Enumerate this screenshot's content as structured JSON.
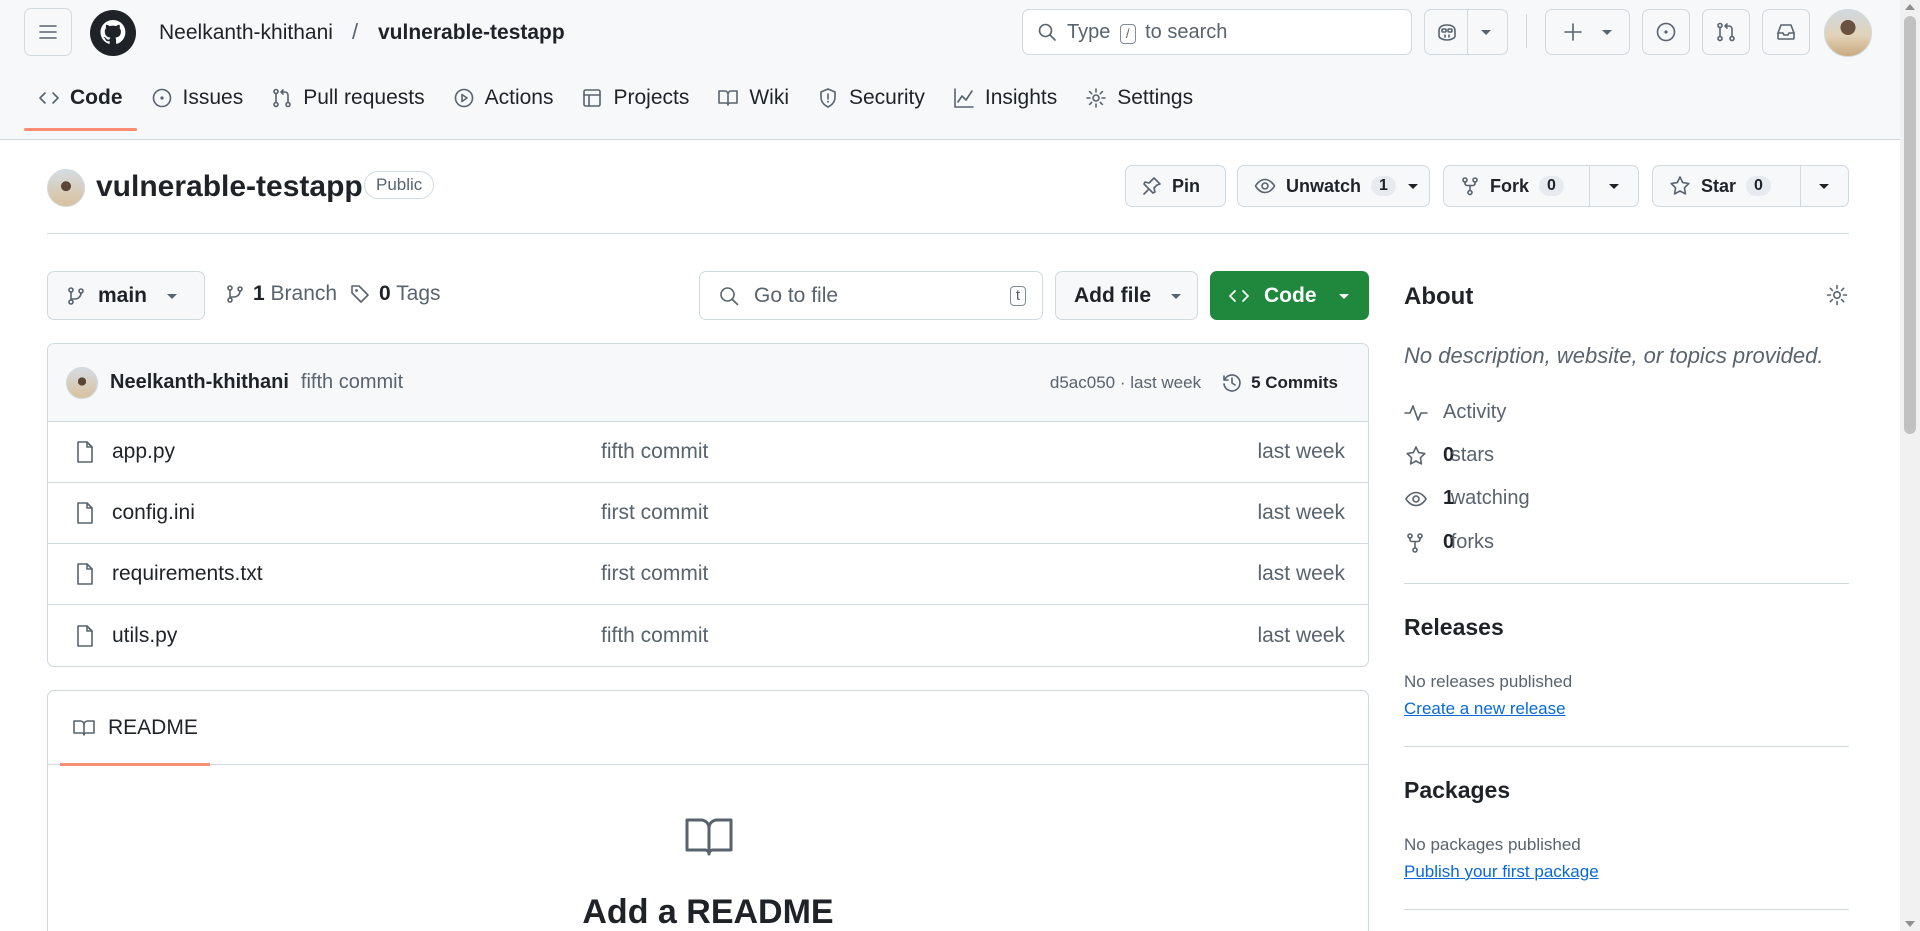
{
  "header": {
    "owner": "Neelkanth-khithani",
    "separator": "/",
    "repo": "vulnerable-testapp",
    "search": {
      "prefix": "Type",
      "key": "/",
      "suffix": "to search"
    }
  },
  "tabs": [
    {
      "label": "Code",
      "icon": "code-icon"
    },
    {
      "label": "Issues",
      "icon": "issue-opened-icon"
    },
    {
      "label": "Pull requests",
      "icon": "git-pull-request-icon"
    },
    {
      "label": "Actions",
      "icon": "play-icon"
    },
    {
      "label": "Projects",
      "icon": "table-icon"
    },
    {
      "label": "Wiki",
      "icon": "book-icon"
    },
    {
      "label": "Security",
      "icon": "shield-icon"
    },
    {
      "label": "Insights",
      "icon": "graph-icon"
    },
    {
      "label": "Settings",
      "icon": "gear-icon"
    }
  ],
  "repo_header": {
    "name": "vulnerable-testapp",
    "visibility": "Public",
    "pin_label": "Pin",
    "unwatch_label": "Unwatch",
    "watch_count": "1",
    "fork_label": "Fork",
    "fork_count": "0",
    "star_label": "Star",
    "star_count": "0"
  },
  "file_nav": {
    "branch": "main",
    "branch_count": "1",
    "branch_label": "Branch",
    "tag_count": "0",
    "tag_label": "Tags",
    "goto_placeholder": "Go to file",
    "goto_key": "t",
    "add_file_label": "Add file",
    "code_label": "Code"
  },
  "latest_commit": {
    "author": "Neelkanth-khithani",
    "message": "fifth commit",
    "meta": "d5ac050 · last week",
    "commits_label": "5 Commits"
  },
  "files": [
    {
      "name": "app.py",
      "message": "fifth commit",
      "time": "last week"
    },
    {
      "name": "config.ini",
      "message": "first commit",
      "time": "last week"
    },
    {
      "name": "requirements.txt",
      "message": "first commit",
      "time": "last week"
    },
    {
      "name": "utils.py",
      "message": "fifth commit",
      "time": "last week"
    }
  ],
  "readme": {
    "tab_label": "README",
    "heading": "Add a README"
  },
  "about": {
    "title": "About",
    "description": "No description, website, or topics provided.",
    "activity_label": "Activity",
    "stars_count": "0",
    "stars_label": "stars",
    "watching_count": "1",
    "watching_label": "watching",
    "forks_count": "0",
    "forks_label": "forks"
  },
  "releases": {
    "title": "Releases",
    "note": "No releases published",
    "link": "Create a new release"
  },
  "packages": {
    "title": "Packages",
    "note": "No packages published",
    "link": "Publish your first package"
  },
  "colors": {
    "accent_underline": "#fd8c73",
    "code_button": "#1f883d",
    "link": "#0969da"
  }
}
